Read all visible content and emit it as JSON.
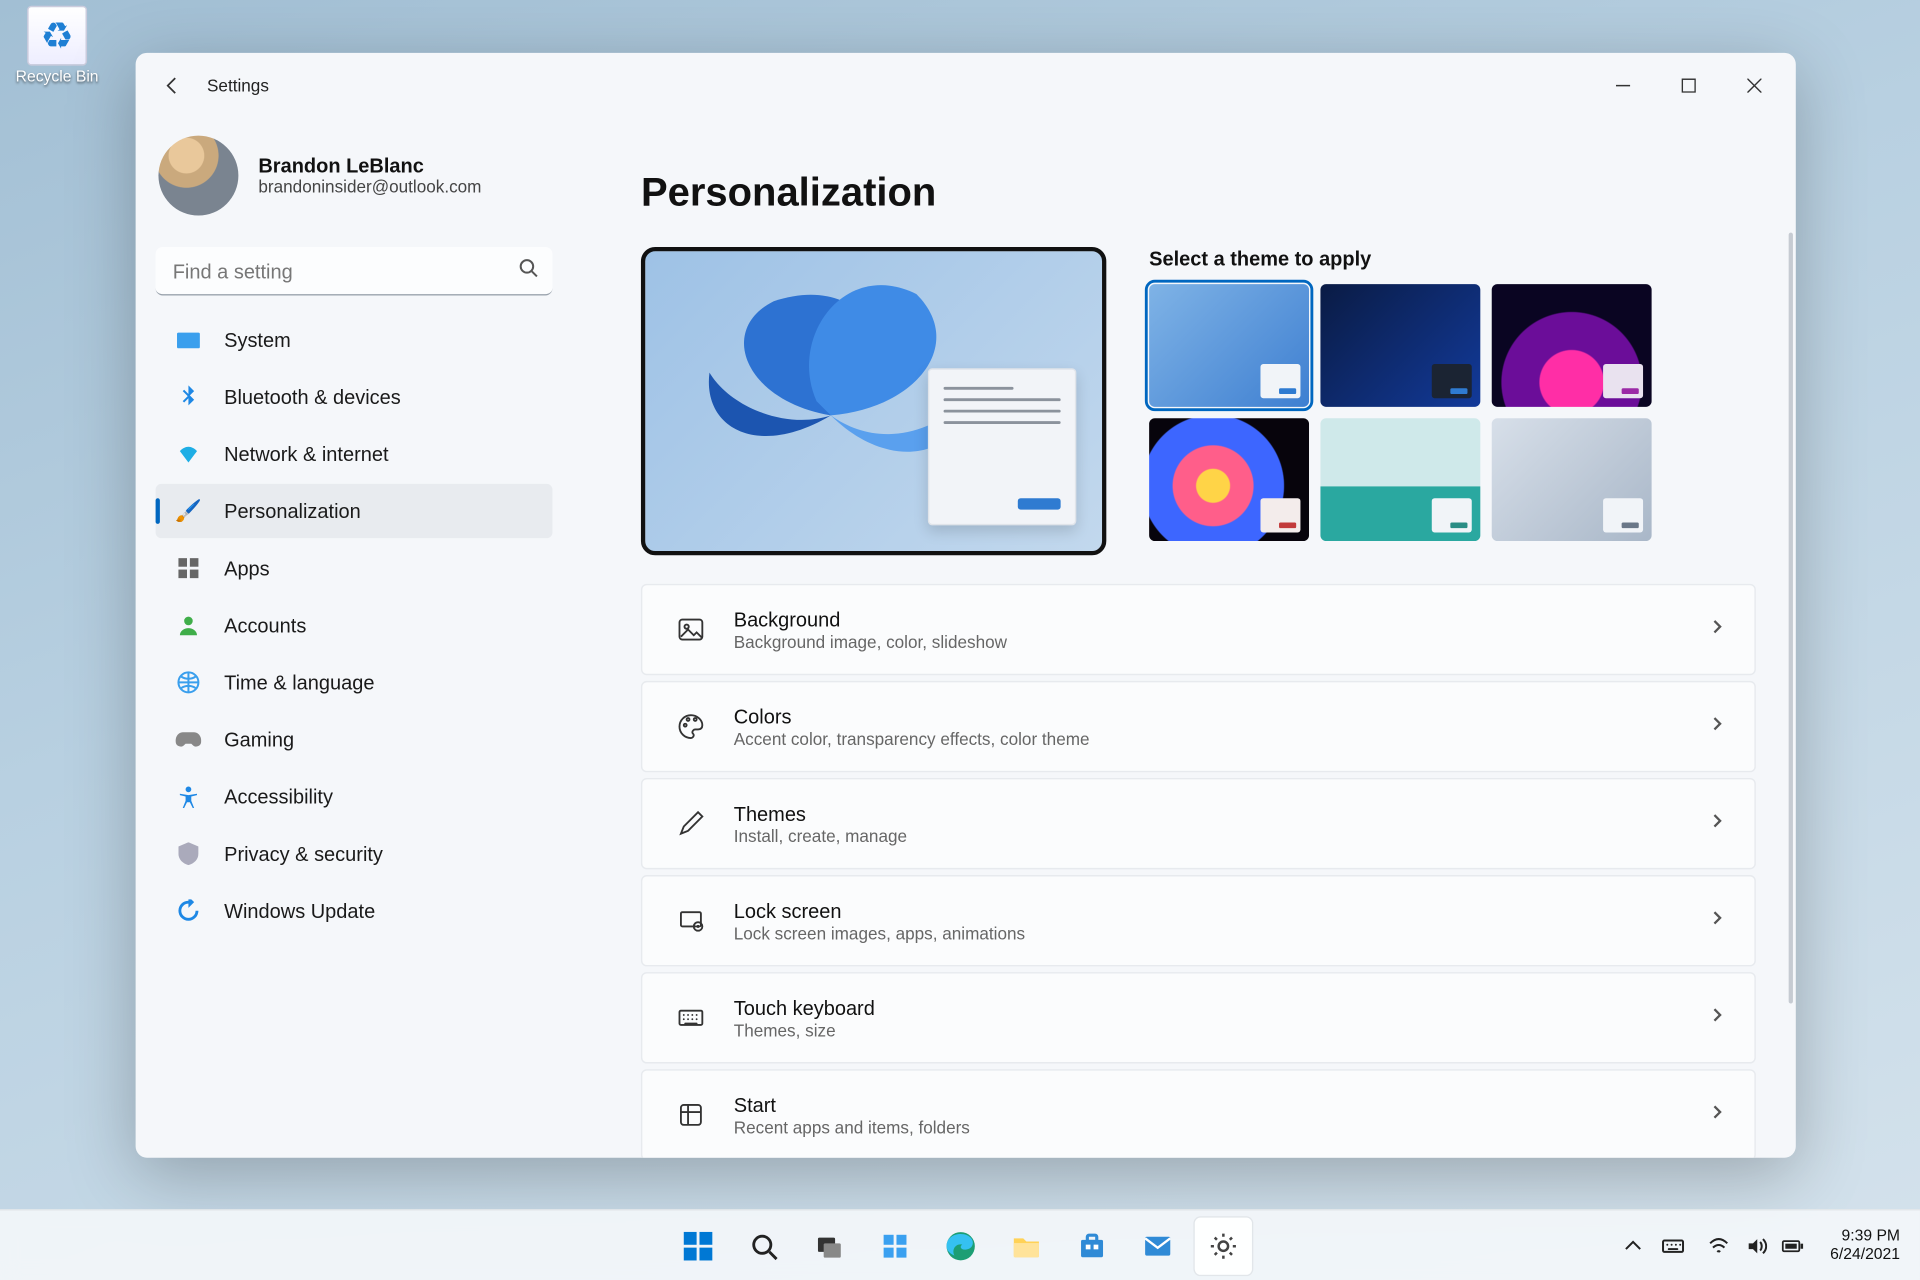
{
  "desktop": {
    "recycle_bin": "Recycle Bin"
  },
  "window": {
    "app_title": "Settings",
    "profile": {
      "name": "Brandon LeBlanc",
      "email": "brandoninsider@outlook.com"
    },
    "search_placeholder": "Find a setting",
    "nav": [
      {
        "icon": "🖥️",
        "label": "System"
      },
      {
        "icon": "▶",
        "label": "Bluetooth & devices",
        "ico_html": "bt"
      },
      {
        "icon": "🛜",
        "label": "Network & internet",
        "ico_html": "wifi"
      },
      {
        "icon": "🖌️",
        "label": "Personalization",
        "active": true
      },
      {
        "icon": "▦",
        "label": "Apps",
        "ico_html": "apps"
      },
      {
        "icon": "👤",
        "label": "Accounts",
        "ico_html": "acct"
      },
      {
        "icon": "🌐",
        "label": "Time & language",
        "ico_html": "time"
      },
      {
        "icon": "🎮",
        "label": "Gaming",
        "ico_html": "game"
      },
      {
        "icon": "✖",
        "label": "Accessibility",
        "ico_html": "access"
      },
      {
        "icon": "🛡️",
        "label": "Privacy & security",
        "ico_html": "shield"
      },
      {
        "icon": "🔄",
        "label": "Windows Update",
        "ico_html": "update"
      }
    ],
    "page_title": "Personalization",
    "themes_heading": "Select a theme to apply",
    "cards": [
      {
        "title": "Background",
        "sub": "Background image, color, slideshow",
        "icon": "image"
      },
      {
        "title": "Colors",
        "sub": "Accent color, transparency effects, color theme",
        "icon": "palette"
      },
      {
        "title": "Themes",
        "sub": "Install, create, manage",
        "icon": "pen"
      },
      {
        "title": "Lock screen",
        "sub": "Lock screen images, apps, animations",
        "icon": "lock"
      },
      {
        "title": "Touch keyboard",
        "sub": "Themes, size",
        "icon": "keyboard"
      },
      {
        "title": "Start",
        "sub": "Recent apps and items, folders",
        "icon": "start"
      }
    ]
  },
  "taskbar": {
    "time": "9:39 PM",
    "date": "6/24/2021"
  }
}
